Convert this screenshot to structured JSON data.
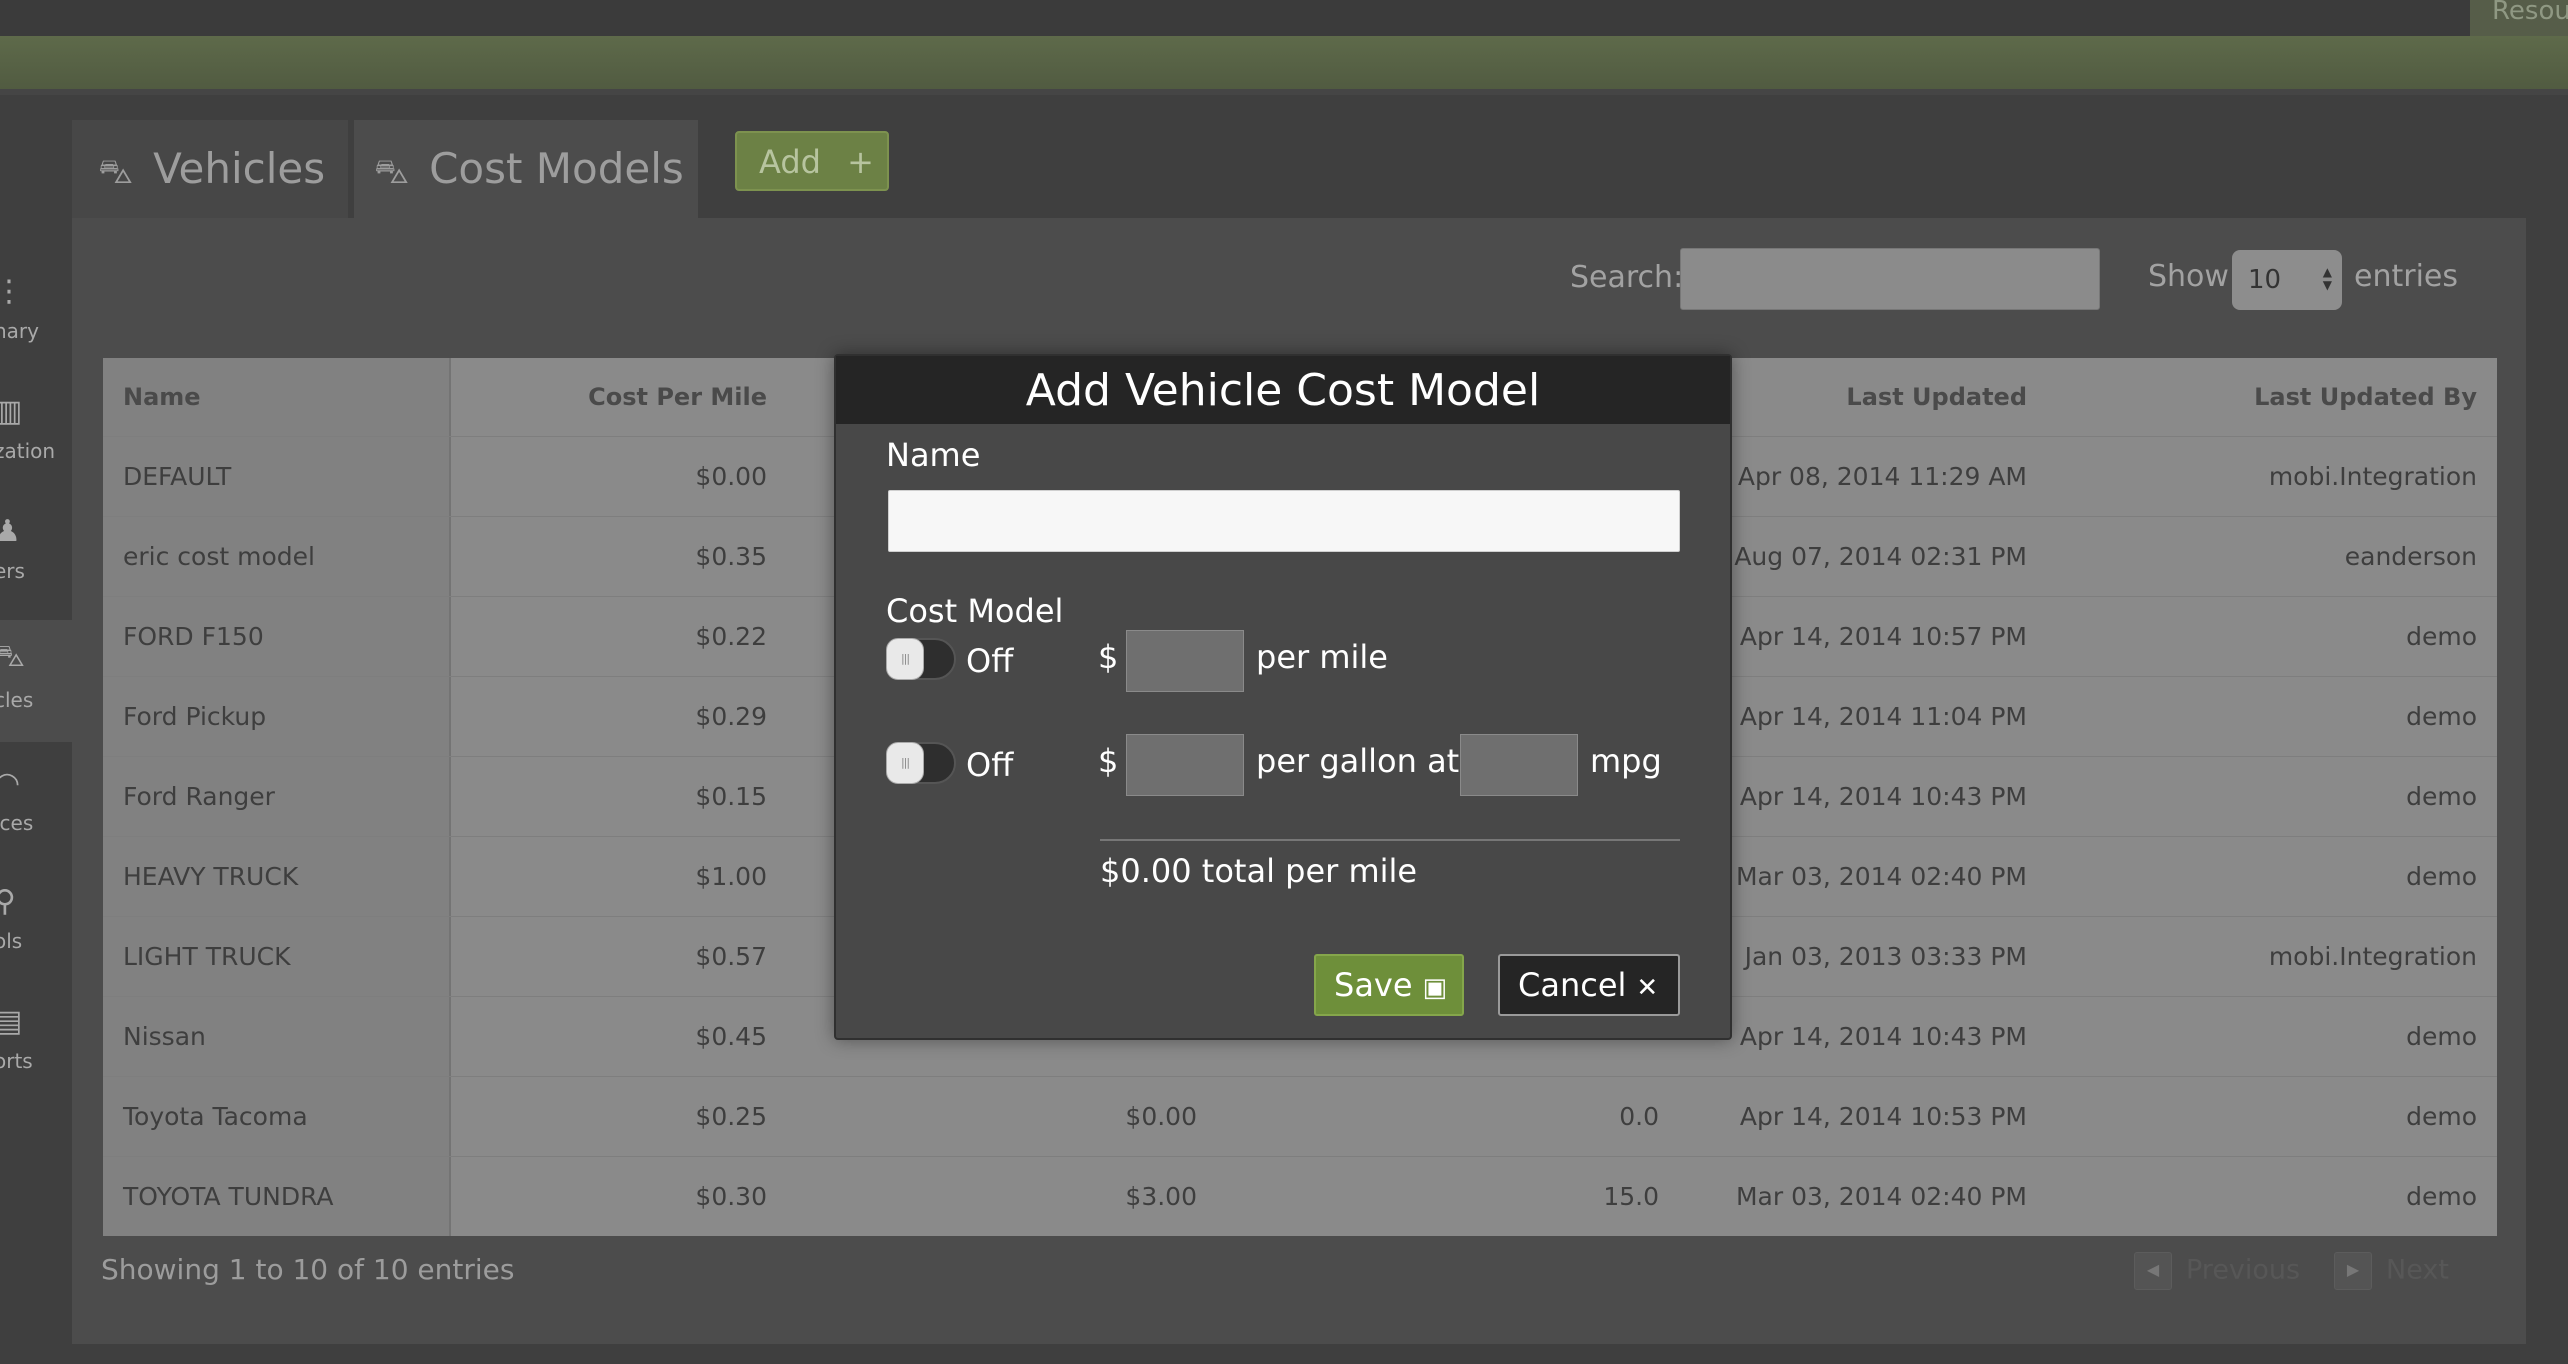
{
  "header": {
    "resources_tab": "Resources"
  },
  "sidebar": {
    "items": [
      {
        "label": "Summary",
        "visible_label": "nary",
        "icon": "dots-icon"
      },
      {
        "label": "Organization",
        "visible_label": "zation",
        "icon": "building-icon"
      },
      {
        "label": "Drivers",
        "visible_label": "ers",
        "icon": "person-icon"
      },
      {
        "label": "Vehicles",
        "visible_label": "cles",
        "icon": "car-icon",
        "active": true
      },
      {
        "label": "Devices",
        "visible_label": "ices",
        "icon": "signal-icon"
      },
      {
        "label": "Tools",
        "visible_label": "ols",
        "icon": "pin-icon"
      },
      {
        "label": "Reports",
        "visible_label": "orts",
        "icon": "report-icon"
      }
    ]
  },
  "tabs": [
    {
      "label": "Vehicles",
      "icon": "car-icon"
    },
    {
      "label": "Cost Models",
      "icon": "money-car-icon",
      "active": true
    }
  ],
  "add_button": {
    "label": "Add",
    "icon": "plus-icon"
  },
  "table_controls": {
    "search_label": "Search:",
    "search_value": "",
    "show_label": "Show",
    "entries_value": "10",
    "entries_label": "entries"
  },
  "table": {
    "columns": [
      "Name",
      "Cost Per Mile",
      "",
      "",
      "Last Updated",
      "Last Updated By"
    ],
    "rows": [
      {
        "name": "DEFAULT",
        "cpm": "$0.00",
        "fuel": "",
        "mpg": "",
        "updated": "Apr 08, 2014 11:29 AM",
        "by": "mobi.Integration"
      },
      {
        "name": "eric cost model",
        "cpm": "$0.35",
        "fuel": "",
        "mpg": "",
        "updated": "Aug 07, 2014 02:31 PM",
        "by": "eanderson"
      },
      {
        "name": "FORD F150",
        "cpm": "$0.22",
        "fuel": "",
        "mpg": "",
        "updated": "Apr 14, 2014 10:57 PM",
        "by": "demo"
      },
      {
        "name": "Ford Pickup",
        "cpm": "$0.29",
        "fuel": "",
        "mpg": "",
        "updated": "Apr 14, 2014 11:04 PM",
        "by": "demo"
      },
      {
        "name": "Ford Ranger",
        "cpm": "$0.15",
        "fuel": "",
        "mpg": "",
        "updated": "Apr 14, 2014 10:43 PM",
        "by": "demo"
      },
      {
        "name": "HEAVY TRUCK",
        "cpm": "$1.00",
        "fuel": "",
        "mpg": "",
        "updated": "Mar 03, 2014 02:40 PM",
        "by": "demo"
      },
      {
        "name": "LIGHT TRUCK",
        "cpm": "$0.57",
        "fuel": "",
        "mpg": "",
        "updated": "Jan 03, 2013 03:33 PM",
        "by": "mobi.Integration"
      },
      {
        "name": "Nissan",
        "cpm": "$0.45",
        "fuel": "",
        "mpg": "",
        "updated": "Apr 14, 2014 10:43 PM",
        "by": "demo"
      },
      {
        "name": "Toyota Tacoma",
        "cpm": "$0.25",
        "fuel": "$0.00",
        "mpg": "0.0",
        "updated": "Apr 14, 2014 10:53 PM",
        "by": "demo"
      },
      {
        "name": "TOYOTA TUNDRA",
        "cpm": "$0.30",
        "fuel": "$3.00",
        "mpg": "15.0",
        "updated": "Mar 03, 2014 02:40 PM",
        "by": "demo"
      }
    ]
  },
  "footer": {
    "info": "Showing 1 to 10 of 10 entries",
    "previous": "Previous",
    "next": "Next"
  },
  "modal": {
    "title": "Add Vehicle Cost Model",
    "name_label": "Name",
    "name_value": "",
    "cost_model_label": "Cost Model",
    "row1": {
      "toggle": "Off",
      "currency": "$",
      "value": "",
      "suffix": "per mile"
    },
    "row2": {
      "toggle": "Off",
      "currency": "$",
      "value": "",
      "middle": "per gallon at",
      "mpg_value": "",
      "suffix": "mpg"
    },
    "total": "$0.00 total per mile",
    "save_label": "Save",
    "cancel_label": "Cancel"
  },
  "colors": {
    "accent_green": "#6e8f3a",
    "modal_header": "#252525",
    "band": "#5e6a4a"
  }
}
